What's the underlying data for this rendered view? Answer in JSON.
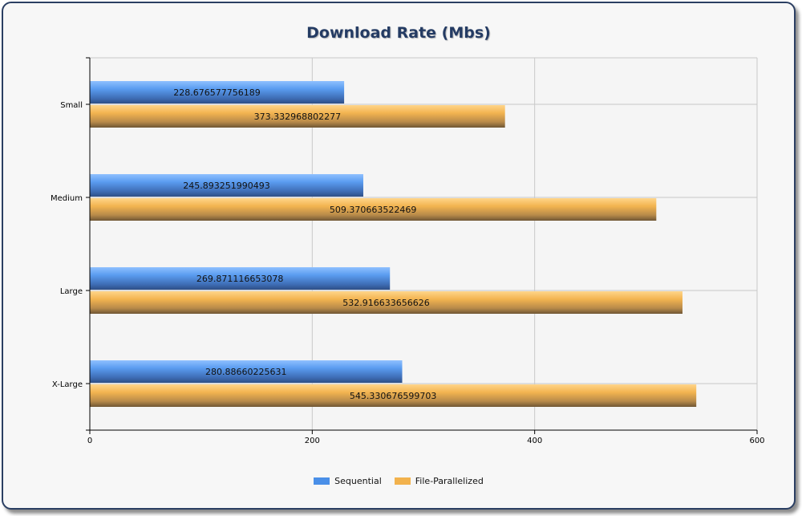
{
  "chart_data": {
    "type": "bar",
    "orientation": "horizontal",
    "title": "Download Rate (Mbs)",
    "categories": [
      "Small",
      "Medium",
      "Large",
      "X-Large"
    ],
    "series": [
      {
        "name": "Sequential",
        "color": "#4a8fe8",
        "values": [
          228.676577756189,
          245.893251990493,
          269.871116653078,
          280.88660225631
        ],
        "labels": [
          "228.676577756189",
          "245.893251990493",
          "269.871116653078",
          "280.88660225631"
        ]
      },
      {
        "name": "File-Parallelized",
        "color": "#f2b24d",
        "values": [
          373.332968802277,
          509.370663522469,
          532.916633656626,
          545.330676599703
        ],
        "labels": [
          "373.332968802277",
          "509.370663522469",
          "532.916633656626",
          "545.330676599703"
        ]
      }
    ],
    "xlim": [
      0,
      600
    ],
    "xticks": [
      0,
      200,
      400,
      600
    ],
    "xtick_labels": [
      "0",
      "200",
      "400",
      "600"
    ],
    "grid": true,
    "legend_position": "bottom-center"
  }
}
